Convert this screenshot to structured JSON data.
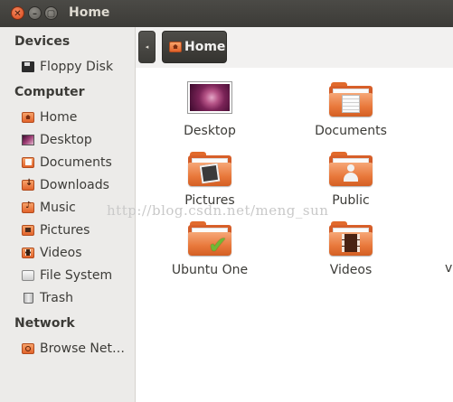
{
  "window": {
    "title": "Home"
  },
  "titlebar": {
    "close_glyph": "✕",
    "minimize_glyph": "–",
    "maximize_glyph": "▢"
  },
  "sidebar": {
    "devices_heading": "Devices",
    "devices": [
      {
        "label": "Floppy Disk",
        "icon": "floppy-icon"
      }
    ],
    "computer_heading": "Computer",
    "computer": [
      {
        "label": "Home",
        "icon": "home-folder-icon"
      },
      {
        "label": "Desktop",
        "icon": "desktop-icon"
      },
      {
        "label": "Documents",
        "icon": "documents-folder-icon"
      },
      {
        "label": "Downloads",
        "icon": "downloads-folder-icon"
      },
      {
        "label": "Music",
        "icon": "music-folder-icon"
      },
      {
        "label": "Pictures",
        "icon": "pictures-folder-icon"
      },
      {
        "label": "Videos",
        "icon": "videos-folder-icon"
      },
      {
        "label": "File System",
        "icon": "drive-icon"
      },
      {
        "label": "Trash",
        "icon": "trash-icon"
      }
    ],
    "network_heading": "Network",
    "network": [
      {
        "label": "Browse Net…",
        "icon": "network-icon"
      }
    ]
  },
  "toolbar": {
    "back_glyph": "◂",
    "breadcrumb": "Home"
  },
  "files": [
    {
      "label": "Desktop",
      "icon": "desktop-icon"
    },
    {
      "label": "Documents",
      "icon": "documents-folder-icon"
    },
    {
      "label": "Pictures",
      "icon": "pictures-folder-icon"
    },
    {
      "label": "Public",
      "icon": "public-folder-icon"
    },
    {
      "label": "Ubuntu One",
      "icon": "ubuntu-one-folder-icon"
    },
    {
      "label": "Videos",
      "icon": "videos-folder-icon"
    }
  ],
  "partial_item_label": "v",
  "watermark": "http://blog.csdn.net/meng_sun",
  "colors": {
    "accent": "#e2632b",
    "titlebar": "#3c3b37",
    "sidebar_bg": "#ecebe9"
  }
}
